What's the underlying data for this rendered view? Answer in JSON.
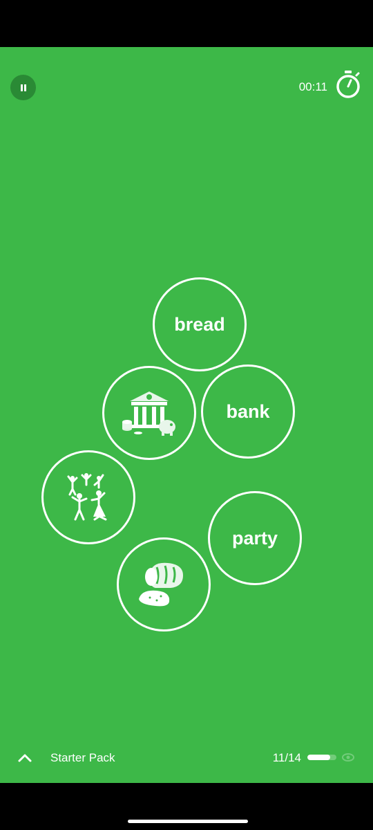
{
  "header": {
    "timer": "00:11",
    "pause_icon": "pause-icon",
    "stopwatch_icon": "stopwatch-icon"
  },
  "bubbles": [
    {
      "kind": "word",
      "label": "bread"
    },
    {
      "kind": "image",
      "icon": "bank-building-icon"
    },
    {
      "kind": "word",
      "label": "bank"
    },
    {
      "kind": "image",
      "icon": "party-people-icon"
    },
    {
      "kind": "word",
      "label": "party"
    },
    {
      "kind": "image",
      "icon": "bread-loaf-icon"
    }
  ],
  "footer": {
    "pack_name": "Starter Pack",
    "progress_text": "11/14",
    "progress_fraction": 0.786,
    "chevron_icon": "chevron-up-icon",
    "eye_icon": "eye-icon"
  },
  "colors": {
    "background": "#3db848",
    "pause_button": "#2a8a35",
    "text": "#ffffff"
  }
}
